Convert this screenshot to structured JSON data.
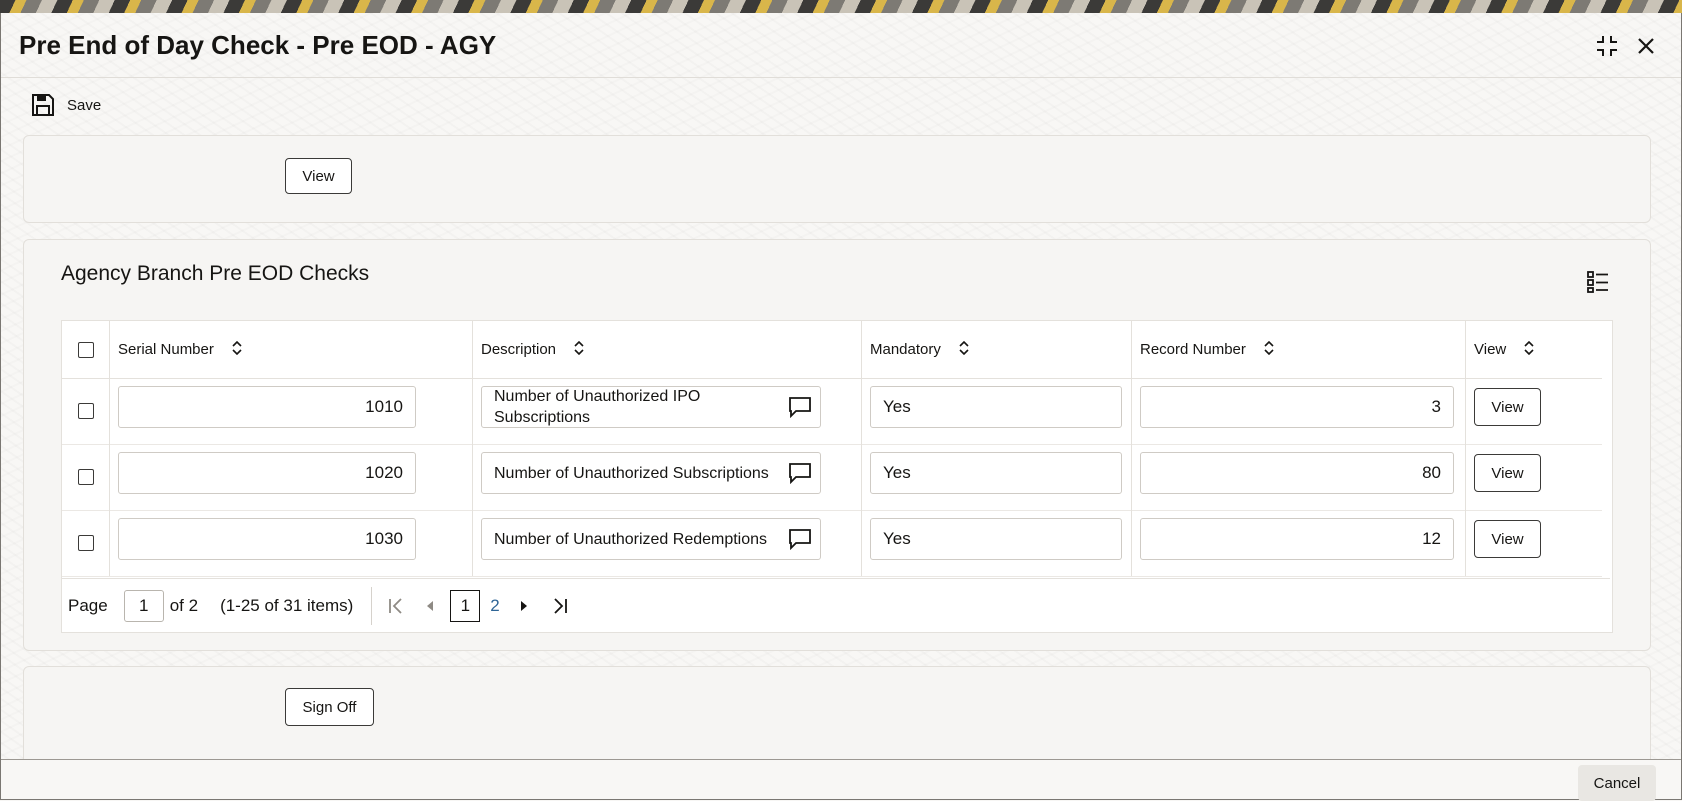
{
  "window": {
    "title": "Pre End of Day Check - Pre EOD - AGY"
  },
  "toolbar": {
    "save_label": "Save"
  },
  "top_panel": {
    "view_label": "View"
  },
  "checks": {
    "section_title": "Agency Branch Pre EOD Checks",
    "columns": [
      "Serial Number",
      "Description",
      "Mandatory",
      "Record Number",
      "View"
    ],
    "rows": [
      {
        "serial": "1010",
        "description": "Number of Unauthorized IPO Subscriptions",
        "mandatory": "Yes",
        "record": "3",
        "view": "View"
      },
      {
        "serial": "1020",
        "description": "Number of Unauthorized Subscriptions",
        "mandatory": "Yes",
        "record": "80",
        "view": "View"
      },
      {
        "serial": "1030",
        "description": "Number of Unauthorized Redemptions",
        "mandatory": "Yes",
        "record": "12",
        "view": "View"
      }
    ],
    "pagination": {
      "page_label": "Page",
      "current_page": "1",
      "of_label": "of 2",
      "items_label": "(1-25 of 31 items)",
      "pages": [
        "1",
        "2"
      ]
    }
  },
  "bottom_panel": {
    "sign_off_label": "Sign Off"
  },
  "footer": {
    "cancel_label": "Cancel"
  }
}
